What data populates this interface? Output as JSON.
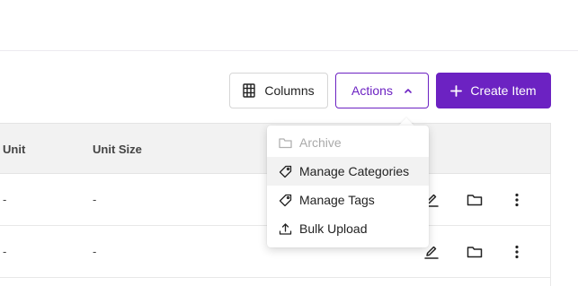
{
  "toolbar": {
    "columns_label": "Columns",
    "actions_label": "Actions",
    "create_label": "Create Item"
  },
  "table": {
    "headers": [
      "Unit",
      "Unit Size"
    ],
    "rows": [
      {
        "unit": "-",
        "unit_size": "-"
      },
      {
        "unit": "-",
        "unit_size": "-"
      }
    ]
  },
  "actions_menu": {
    "items": [
      {
        "label": "Archive",
        "icon": "folder-icon",
        "disabled": true
      },
      {
        "label": "Manage Categories",
        "icon": "tag-icon",
        "highlighted": true
      },
      {
        "label": "Manage Tags",
        "icon": "tag-icon"
      },
      {
        "label": "Bulk Upload",
        "icon": "upload-icon"
      }
    ]
  },
  "colors": {
    "accent": "#6c22c2",
    "header_bg": "#f2f2f2",
    "disabled_text": "#aaaaaa"
  }
}
